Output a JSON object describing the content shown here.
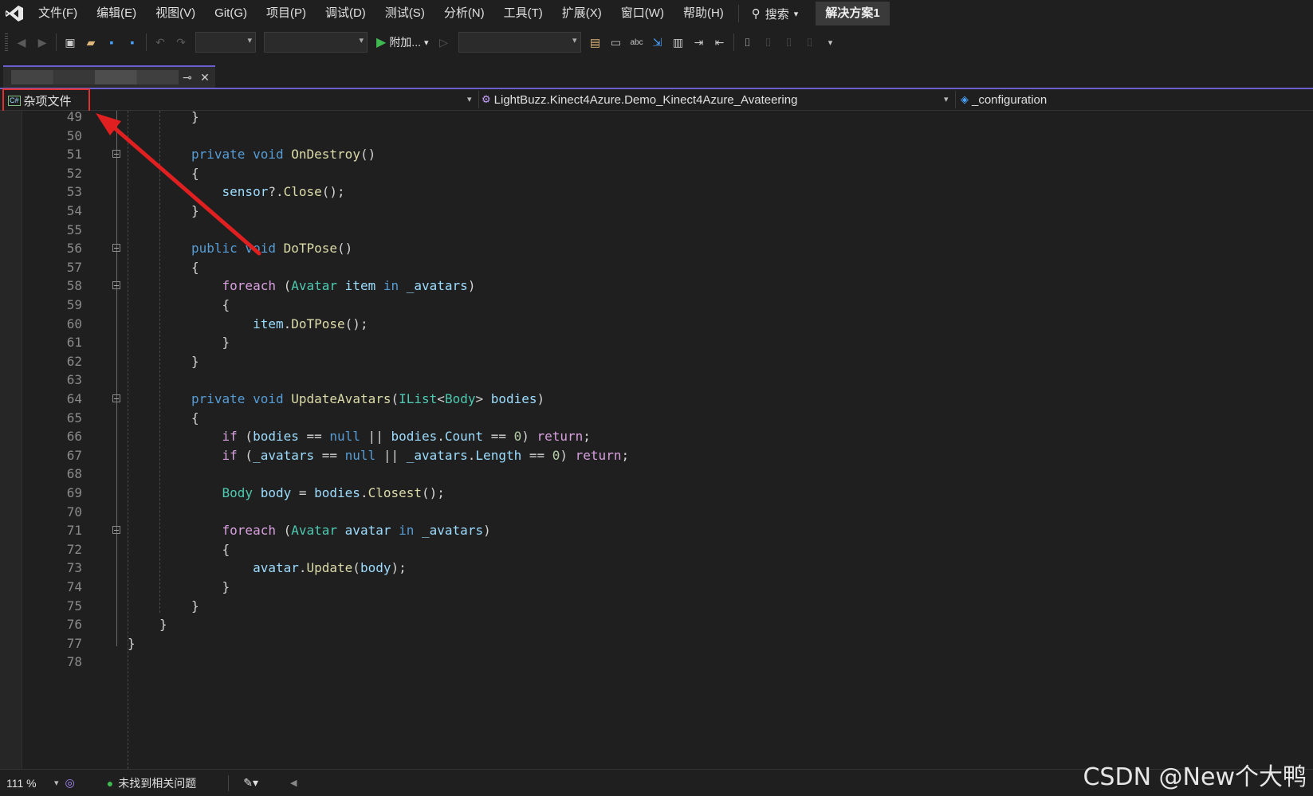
{
  "menu": {
    "items": [
      "文件(F)",
      "编辑(E)",
      "视图(V)",
      "Git(G)",
      "项目(P)",
      "调试(D)",
      "测试(S)",
      "分析(N)",
      "工具(T)",
      "扩展(X)",
      "窗口(W)",
      "帮助(H)"
    ],
    "search_label": "搜索",
    "solution_name": "解决方案1"
  },
  "toolbar": {
    "attach_label": "附加..."
  },
  "navbar": {
    "project": "杂项文件",
    "class": "LightBuzz.Kinect4Azure.Demo_Kinect4Azure_Avateering",
    "member": "_configuration"
  },
  "code_lines": [
    {
      "n": "49",
      "tokens": [
        [
          "pun",
          "}"
        ]
      ]
    },
    {
      "n": "50",
      "tokens": []
    },
    {
      "n": "51",
      "tokens": [
        [
          "kw",
          "private"
        ],
        [
          "pun",
          " "
        ],
        [
          "kw",
          "void"
        ],
        [
          "pun",
          " "
        ],
        [
          "fn",
          "OnDestroy"
        ],
        [
          "pun",
          "()"
        ]
      ]
    },
    {
      "n": "52",
      "tokens": [
        [
          "pun",
          "{"
        ]
      ]
    },
    {
      "n": "53",
      "tokens": [
        [
          "pun",
          "    "
        ],
        [
          "var",
          "sensor"
        ],
        [
          "pun",
          "?."
        ],
        [
          "fn",
          "Close"
        ],
        [
          "pun",
          "();"
        ]
      ]
    },
    {
      "n": "54",
      "tokens": [
        [
          "pun",
          "}"
        ]
      ]
    },
    {
      "n": "55",
      "tokens": []
    },
    {
      "n": "56",
      "tokens": [
        [
          "kw",
          "public"
        ],
        [
          "pun",
          " "
        ],
        [
          "kw",
          "void"
        ],
        [
          "pun",
          " "
        ],
        [
          "fn",
          "DoTPose"
        ],
        [
          "pun",
          "()"
        ]
      ]
    },
    {
      "n": "57",
      "tokens": [
        [
          "pun",
          "{"
        ]
      ]
    },
    {
      "n": "58",
      "tokens": [
        [
          "pun",
          "    "
        ],
        [
          "ctl",
          "foreach"
        ],
        [
          "pun",
          " ("
        ],
        [
          "typ",
          "Avatar"
        ],
        [
          "pun",
          " "
        ],
        [
          "var",
          "item"
        ],
        [
          "pun",
          " "
        ],
        [
          "kw",
          "in"
        ],
        [
          "pun",
          " "
        ],
        [
          "var",
          "_avatars"
        ],
        [
          "pun",
          ")"
        ]
      ]
    },
    {
      "n": "59",
      "tokens": [
        [
          "pun",
          "    {"
        ]
      ]
    },
    {
      "n": "60",
      "tokens": [
        [
          "pun",
          "        "
        ],
        [
          "var",
          "item"
        ],
        [
          "pun",
          "."
        ],
        [
          "fn",
          "DoTPose"
        ],
        [
          "pun",
          "();"
        ]
      ]
    },
    {
      "n": "61",
      "tokens": [
        [
          "pun",
          "    }"
        ]
      ]
    },
    {
      "n": "62",
      "tokens": [
        [
          "pun",
          "}"
        ]
      ]
    },
    {
      "n": "63",
      "tokens": []
    },
    {
      "n": "64",
      "tokens": [
        [
          "kw",
          "private"
        ],
        [
          "pun",
          " "
        ],
        [
          "kw",
          "void"
        ],
        [
          "pun",
          " "
        ],
        [
          "fn",
          "UpdateAvatars"
        ],
        [
          "pun",
          "("
        ],
        [
          "typ",
          "IList"
        ],
        [
          "pun",
          "<"
        ],
        [
          "typ",
          "Body"
        ],
        [
          "pun",
          "> "
        ],
        [
          "var",
          "bodies"
        ],
        [
          "pun",
          ")"
        ]
      ]
    },
    {
      "n": "65",
      "tokens": [
        [
          "pun",
          "{"
        ]
      ]
    },
    {
      "n": "66",
      "tokens": [
        [
          "pun",
          "    "
        ],
        [
          "ctl",
          "if"
        ],
        [
          "pun",
          " ("
        ],
        [
          "var",
          "bodies"
        ],
        [
          "pun",
          " == "
        ],
        [
          "kw",
          "null"
        ],
        [
          "pun",
          " || "
        ],
        [
          "var",
          "bodies"
        ],
        [
          "pun",
          "."
        ],
        [
          "var",
          "Count"
        ],
        [
          "pun",
          " == "
        ],
        [
          "num",
          "0"
        ],
        [
          "pun",
          ") "
        ],
        [
          "ctl",
          "return"
        ],
        [
          "pun",
          ";"
        ]
      ]
    },
    {
      "n": "67",
      "tokens": [
        [
          "pun",
          "    "
        ],
        [
          "ctl",
          "if"
        ],
        [
          "pun",
          " ("
        ],
        [
          "var",
          "_avatars"
        ],
        [
          "pun",
          " == "
        ],
        [
          "kw",
          "null"
        ],
        [
          "pun",
          " || "
        ],
        [
          "var",
          "_avatars"
        ],
        [
          "pun",
          "."
        ],
        [
          "var",
          "Length"
        ],
        [
          "pun",
          " == "
        ],
        [
          "num",
          "0"
        ],
        [
          "pun",
          ") "
        ],
        [
          "ctl",
          "return"
        ],
        [
          "pun",
          ";"
        ]
      ]
    },
    {
      "n": "68",
      "tokens": []
    },
    {
      "n": "69",
      "tokens": [
        [
          "pun",
          "    "
        ],
        [
          "typ",
          "Body"
        ],
        [
          "pun",
          " "
        ],
        [
          "var",
          "body"
        ],
        [
          "pun",
          " = "
        ],
        [
          "var",
          "bodies"
        ],
        [
          "pun",
          "."
        ],
        [
          "fn",
          "Closest"
        ],
        [
          "pun",
          "();"
        ]
      ]
    },
    {
      "n": "70",
      "tokens": []
    },
    {
      "n": "71",
      "tokens": [
        [
          "pun",
          "    "
        ],
        [
          "ctl",
          "foreach"
        ],
        [
          "pun",
          " ("
        ],
        [
          "typ",
          "Avatar"
        ],
        [
          "pun",
          " "
        ],
        [
          "var",
          "avatar"
        ],
        [
          "pun",
          " "
        ],
        [
          "kw",
          "in"
        ],
        [
          "pun",
          " "
        ],
        [
          "var",
          "_avatars"
        ],
        [
          "pun",
          ")"
        ]
      ]
    },
    {
      "n": "72",
      "tokens": [
        [
          "pun",
          "    {"
        ]
      ]
    },
    {
      "n": "73",
      "tokens": [
        [
          "pun",
          "        "
        ],
        [
          "var",
          "avatar"
        ],
        [
          "pun",
          "."
        ],
        [
          "fn",
          "Update"
        ],
        [
          "pun",
          "("
        ],
        [
          "var",
          "body"
        ],
        [
          "pun",
          ");"
        ]
      ]
    },
    {
      "n": "74",
      "tokens": [
        [
          "pun",
          "    }"
        ]
      ]
    },
    {
      "n": "75",
      "tokens": [
        [
          "pun",
          "}"
        ]
      ]
    },
    {
      "n": "76",
      "tokens": [
        [
          "pun",
          "}"
        ]
      ]
    },
    {
      "n": "77",
      "tokens": [
        [
          "pun",
          "}"
        ]
      ]
    },
    {
      "n": "78",
      "tokens": []
    }
  ],
  "status": {
    "zoom": "111 %",
    "issues": "未找到相关问题"
  },
  "watermark": "CSDN @New个大鸭",
  "colors": {
    "accent": "#6b5fcf",
    "highlight_box": "#e03030",
    "arrow": "#e02020"
  }
}
